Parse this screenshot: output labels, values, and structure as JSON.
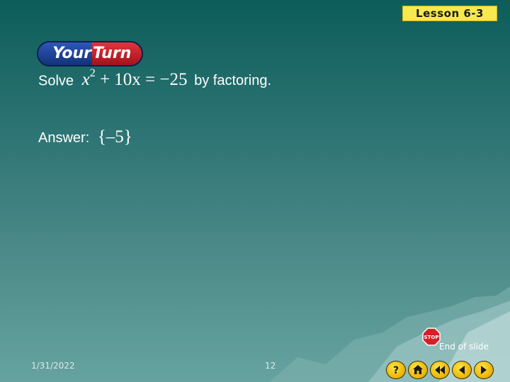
{
  "header": {
    "lesson_label": "Lesson 6-3"
  },
  "badge": {
    "left_text": "Your",
    "right_text": "Turn"
  },
  "problem": {
    "prefix": "Solve",
    "equation": {
      "base": "x",
      "exponent": "2",
      "rest": " + 10x = −25"
    },
    "suffix": "by factoring."
  },
  "answer": {
    "label": "Answer:",
    "value": "{–5}"
  },
  "footer": {
    "date": "1/31/2022",
    "page_number": "12"
  },
  "end_of_slide": {
    "label": "End of slide",
    "sign_text": "STOP"
  },
  "nav": {
    "buttons": [
      {
        "icon": "help-icon",
        "glyph": "?"
      },
      {
        "icon": "home-icon"
      },
      {
        "icon": "rewind-icon"
      },
      {
        "icon": "previous-icon"
      },
      {
        "icon": "next-icon"
      }
    ]
  },
  "colors": {
    "background_top": "#0c5d5a",
    "background_bottom": "#66a3a0",
    "lesson_tag": "#f6e84e",
    "badge_blue": "#1f3f99",
    "badge_red": "#c8232b",
    "nav_button": "#f2c300",
    "text": "#ffffff"
  }
}
